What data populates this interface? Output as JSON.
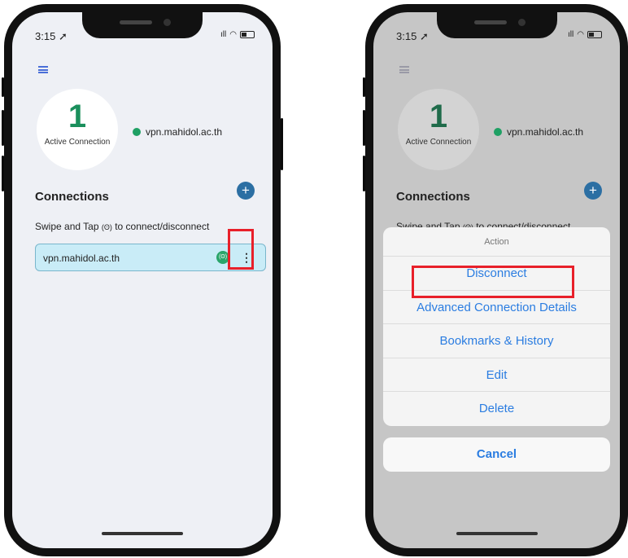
{
  "status": {
    "time": "3:15",
    "signal": "ıll"
  },
  "left_phone": {
    "active_count": "1",
    "active_caption": "Active Connection",
    "host": "vpn.mahidol.ac.th",
    "connections_title": "Connections",
    "add_symbol": "+",
    "hint_prefix": "Swipe and Tap",
    "hint_icon": "(ʘ)",
    "hint_suffix": "to connect/disconnect",
    "connection_item": {
      "label": "vpn.mahidol.ac.th",
      "icon": "(ʘ)",
      "menu": "⋮"
    }
  },
  "right_phone": {
    "active_count": "1",
    "active_caption": "Active Connection",
    "host": "vpn.mahidol.ac.th",
    "connections_title": "Connections",
    "add_symbol": "+",
    "hint_prefix": "Swipe and Tap",
    "hint_icon": "(ʘ)",
    "hint_suffix": "to connect/disconnect",
    "action_sheet": {
      "title": "Action",
      "options": [
        "Disconnect",
        "Advanced Connection Details",
        "Bookmarks & History",
        "Edit",
        "Delete"
      ],
      "cancel": "Cancel"
    }
  },
  "colors": {
    "accent_blue": "#2b7de1",
    "active_green": "#1fa064",
    "highlight_red": "#e8202a",
    "selected_row": "#c9ecf7"
  }
}
